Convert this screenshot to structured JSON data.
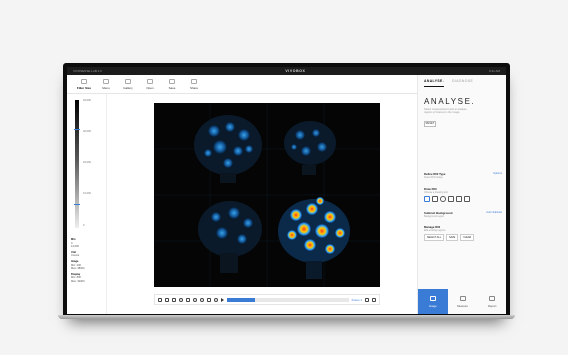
{
  "titlebar": {
    "left_text": "VIVOSENSE LAB 2.0",
    "brand": "VIVOBOX",
    "right_text": "9:41 AM"
  },
  "toolbar": {
    "items": [
      {
        "label": "Filter Size",
        "icon": "filter-icon"
      },
      {
        "label": "Menu",
        "icon": "menu-icon"
      },
      {
        "label": "Gallery",
        "icon": "gallery-icon"
      },
      {
        "label": "Open",
        "icon": "folder-icon"
      },
      {
        "label": "Save",
        "icon": "save-icon"
      },
      {
        "label": "Share",
        "icon": "share-icon"
      }
    ]
  },
  "colorbar": {
    "ticks": [
      "40,000",
      "30,000",
      "20,000",
      "10,000",
      "0"
    ]
  },
  "left_info": {
    "sections": [
      {
        "title": "Min",
        "lines": [
          "0",
          "12,000"
        ]
      },
      {
        "title": "Unit",
        "lines": [
          "Counts"
        ]
      },
      {
        "title": "Image",
        "lines": [
          "Min: 200",
          "Max: 38000"
        ]
      },
      {
        "title": "Display",
        "lines": [
          "Min: 800",
          "Max: 40000"
        ]
      }
    ]
  },
  "controls": {
    "frame_label": "Frame 1",
    "timeline_progress": 0.23
  },
  "rightpanel": {
    "tabs": [
      "ANALYSE.",
      "DIAGNOSE"
    ],
    "title": "ANALYSE.",
    "description": "Select measurement tools to analyse regions of interest in the image.",
    "reset_label": "RESET",
    "roi_type": {
      "label": "Define ROI Type",
      "sub": "Select ROI shape",
      "link": "Options"
    },
    "draw_roi": {
      "label": "Draw ROI",
      "sub": "Choose a drawing tool"
    },
    "background": {
      "label": "Subtract Background",
      "sub": "Background region",
      "link": "Auto Subtract"
    },
    "manage": {
      "label": "Manage ROI",
      "sub": "Edit existing regions",
      "buttons": [
        "SELECT ALL",
        "SAVE",
        "CLEAR"
      ]
    },
    "nav": [
      {
        "label": "Image",
        "icon": "image-icon"
      },
      {
        "label": "Measure",
        "icon": "measure-icon"
      },
      {
        "label": "Report",
        "icon": "report-icon"
      }
    ]
  },
  "colors": {
    "accent": "#3a7bd5",
    "canvas_bg": "#050505"
  }
}
